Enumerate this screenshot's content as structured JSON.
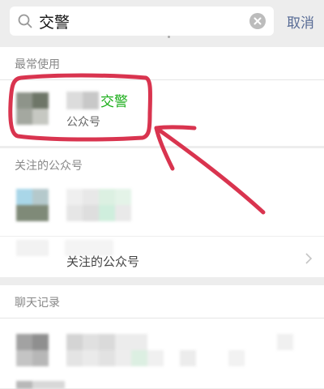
{
  "search": {
    "query": "交警",
    "cancel_label": "取消"
  },
  "sections": {
    "frequent": {
      "title": "最常使用",
      "result": {
        "name": "交警",
        "type": "公众号"
      }
    },
    "followed": {
      "title": "关注的公众号",
      "more_label": "关注的公众号"
    },
    "chat": {
      "title": "聊天记录"
    }
  },
  "colors": {
    "highlight_green": "#1aad19",
    "cancel_blue": "#576b95",
    "annotation_red": "#d9344f"
  }
}
